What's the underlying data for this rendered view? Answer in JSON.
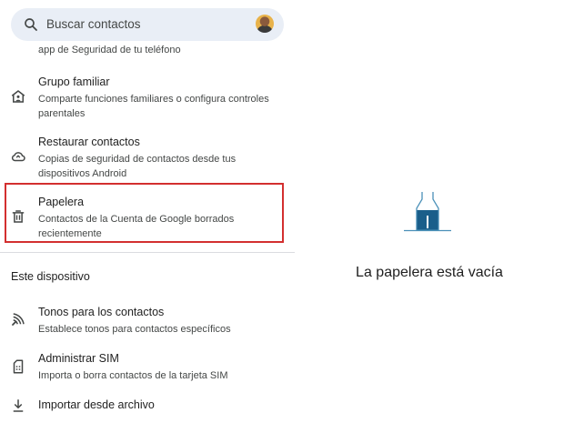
{
  "search": {
    "placeholder": "Buscar contactos"
  },
  "list": {
    "cutoff_text": "app de Seguridad de tu teléfono",
    "items": [
      {
        "title": "Grupo familiar",
        "description": "Comparte funciones familiares o configura controles parentales",
        "icon": "family-home-icon"
      },
      {
        "title": "Restaurar contactos",
        "description": "Copias de seguridad de contactos desde tus dispositivos Android",
        "icon": "cloud-restore-icon"
      },
      {
        "title": "Papelera",
        "description": "Contactos de la Cuenta de Google borrados recientemente",
        "icon": "trash-icon"
      }
    ]
  },
  "device_section": {
    "title": "Este dispositivo",
    "items": [
      {
        "title": "Tonos para los contactos",
        "description": "Establece tonos para contactos específicos",
        "icon": "ringtone-icon"
      },
      {
        "title": "Administrar SIM",
        "description": "Importa o borra contactos de la tarjeta SIM",
        "icon": "sim-card-icon"
      },
      {
        "title": "Importar desde archivo",
        "description": "",
        "icon": "download-icon"
      }
    ]
  },
  "trash_panel": {
    "empty_message": "La papelera está vacía"
  },
  "colors": {
    "search_bg": "#e9eef6",
    "highlight_border": "#d32f2f",
    "illustration_blue": "#1a5e8a",
    "illustration_outline": "#4a90b8"
  }
}
